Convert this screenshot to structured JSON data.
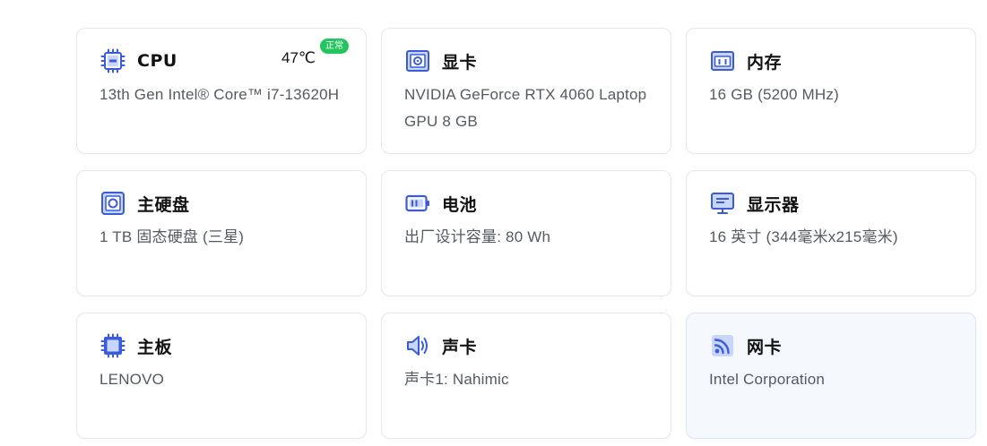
{
  "accent_color": "#3b5bdb",
  "status_color": "#22c55e",
  "cards": [
    {
      "icon": "cpu-icon",
      "title": "CPU",
      "desc": "13th Gen Intel® Core™ i7-13620H",
      "temperature": "47℃",
      "status": "正常"
    },
    {
      "icon": "gpu-icon",
      "title": "显卡",
      "desc": "NVIDIA GeForce RTX 4060 Laptop GPU 8 GB"
    },
    {
      "icon": "memory-icon",
      "title": "内存",
      "desc": "16 GB (5200 MHz)"
    },
    {
      "icon": "hard-disk-icon",
      "title": "主硬盘",
      "desc": "1 TB 固态硬盘 (三星)"
    },
    {
      "icon": "battery-icon",
      "title": "电池",
      "desc": "出厂设计容量: 80 Wh"
    },
    {
      "icon": "monitor-icon",
      "title": "显示器",
      "desc": "16 英寸 (344毫米x215毫米)"
    },
    {
      "icon": "motherboard-icon",
      "title": "主板",
      "desc": "LENOVO"
    },
    {
      "icon": "speaker-icon",
      "title": "声卡",
      "desc": "声卡1: Nahimic"
    },
    {
      "icon": "network-icon",
      "title": "网卡",
      "desc": "Intel Corporation"
    }
  ]
}
